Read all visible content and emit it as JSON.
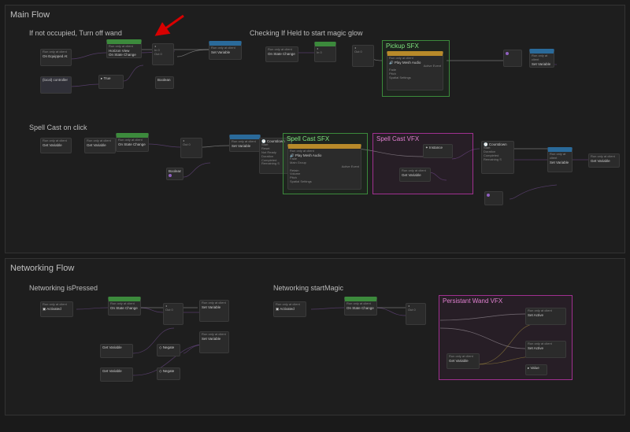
{
  "sections": {
    "main": {
      "title": "Main Flow"
    },
    "net": {
      "title": "Networking Flow"
    }
  },
  "groups": {
    "row1a": {
      "label": "If not occupied, Turn off wand"
    },
    "row1b": {
      "label": "Checking If Held to start magic glow"
    },
    "pickupSFX": {
      "title": "Pickup SFX"
    },
    "row2": {
      "label": "Spell Cast on click"
    },
    "spellSFX": {
      "title": "Spell Cast SFX"
    },
    "spellVFX": {
      "title": "Spell Cast VFX"
    },
    "netA": {
      "label": "Networking isPressed"
    },
    "netB": {
      "label": "Networking startMagic"
    },
    "persistVFX": {
      "title": "Persistant Wand VFX"
    }
  },
  "node_labels": {
    "runat": "Run only at client",
    "horizon_view": "Horizon View",
    "state_change": "On State Change",
    "on_equipped": "On Equipped At",
    "local_ctrl": "(local) controller",
    "play_mesh_audio": "Play Mesh Audio",
    "get_variable": "Get Variable",
    "set_variable": "Set Variable",
    "set_active": "Set Active",
    "countdown": "Countdown",
    "boolean": "Boolean",
    "negate": "Negate",
    "activated": "Activated",
    "instance": "Instance",
    "value": "Value",
    "true": "True"
  },
  "ports": {
    "in": "In 0",
    "out": "Out 0",
    "active_event": "Active Event",
    "start": "Start",
    "reset": "Reset",
    "not_ready": "Not Ready",
    "completed": "Completed",
    "remaining": "Remaining S",
    "duration": "Duration",
    "fade": "Fade",
    "main_group": "Main Group",
    "retain": "Retain",
    "volume": "Volume",
    "pitch": "Pitch",
    "spatial": "Spatial Settings"
  },
  "annotation": {
    "arrow_points_to": "If not occupied, Turn off wand"
  },
  "colors": {
    "green": "#3c8a3c",
    "magenta": "#a03090",
    "purple_wire": "#8a5ab0",
    "arrow_red": "#d80000"
  }
}
